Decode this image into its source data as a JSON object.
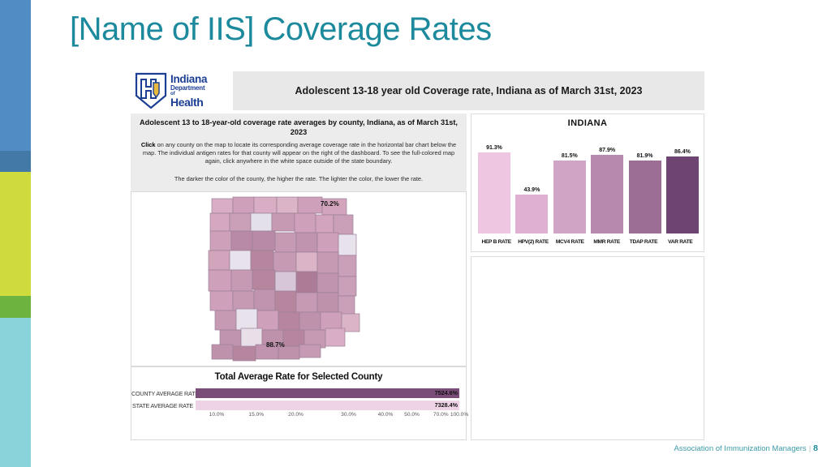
{
  "slide": {
    "title": "[Name of IIS] Coverage Rates",
    "title_color": "#1c8a9c"
  },
  "rail": {
    "segments": [
      {
        "name": "blue",
        "color": "#528cc4"
      },
      {
        "name": "dark-blue",
        "color": "#4279a6"
      },
      {
        "name": "yellow",
        "color": "#cfdb3c"
      },
      {
        "name": "green",
        "color": "#6db33f"
      },
      {
        "name": "cyan",
        "color": "#8bd3db"
      }
    ]
  },
  "dashboard": {
    "logo": {
      "line1": "Indiana",
      "line2": "Department",
      "line3": "of",
      "line4": "Health",
      "shield_color": "#1c3f94",
      "accent_color": "#e8b93a"
    },
    "header_title": "Adolescent 13-18 year old Coverage rate, Indiana as of March 31st, 2023",
    "info": {
      "title": "Adolescent 13 to 18-year-old coverage rate averages by county, Indiana, as of March 31st, 2023",
      "click_word": "Click",
      "body": " on any county on the map to locate its corresponding average coverage rate in the horizontal bar chart below the map. The individual antigen rates for that county will appear on the right of the dashboard. To see the full-colored map again, click anywhere in the white space outside of the state boundary.",
      "note": "The darker the color of the county, the higher the rate. The lighter the color, the lower the rate."
    },
    "map": {
      "label_top": "70.2%",
      "label_bottom": "88.7%"
    },
    "county_chart": {
      "title": "Total Average Rate for Selected County"
    },
    "empty_panel": {}
  },
  "footer": {
    "text": "Association of Immunization Managers",
    "separator": "|",
    "page": "8"
  },
  "chart_data": [
    {
      "type": "bar",
      "title": "INDIANA",
      "orientation": "vertical",
      "categories": [
        "HEP B RATE",
        "HPV(2) RATE",
        "MCV4 RATE",
        "MMR RATE",
        "TDAP RATE",
        "VAR RATE"
      ],
      "values": [
        91.3,
        43.9,
        81.5,
        87.9,
        81.9,
        86.4
      ],
      "labels": [
        "91.3%",
        "43.9%",
        "81.5%",
        "87.9%",
        "81.9%",
        "86.4%"
      ],
      "colors": [
        "#eec6e2",
        "#dfb0d2",
        "#cfa4c4",
        "#b789ae",
        "#9c6e96",
        "#6d4472"
      ],
      "xlabel": "",
      "ylabel": "",
      "ylim": [
        0,
        100
      ],
      "grid": false,
      "legend": "none"
    },
    {
      "type": "bar",
      "title": "Total Average Rate for Selected County",
      "orientation": "horizontal",
      "categories": [
        "COUNTY AVERAGE RATE",
        "STATE AVERAGE RATE"
      ],
      "values": [
        100,
        100
      ],
      "labels": [
        "7524.6%",
        "7328.4%"
      ],
      "colors": [
        "#7a4d79",
        "#eed3e6"
      ],
      "axis_ticks": [
        "10.0%",
        "15.0%",
        "20.0%",
        "30.0%",
        "40.0%",
        "50.0%",
        "70.0%",
        "100.0%"
      ],
      "xlabel": "",
      "ylabel": "",
      "grid": false,
      "legend": "none"
    }
  ]
}
